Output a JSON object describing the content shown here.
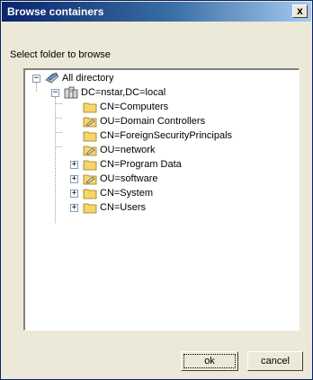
{
  "window": {
    "title": "Browse containers",
    "close_glyph": "x"
  },
  "prompt": "Select folder to browse",
  "tree": {
    "root": {
      "label": "All directory",
      "icon": "directory-icon",
      "expander": "−"
    },
    "domain": {
      "label": "DC=nstar,DC=local",
      "icon": "domain-server-icon",
      "expander": "−"
    },
    "children": [
      {
        "label": "CN=Computers",
        "icon": "folder-icon",
        "expander": ""
      },
      {
        "label": "OU=Domain Controllers",
        "icon": "ou-folder-icon",
        "expander": ""
      },
      {
        "label": "CN=ForeignSecurityPrincipals",
        "icon": "folder-icon",
        "expander": ""
      },
      {
        "label": "OU=network",
        "icon": "ou-folder-icon",
        "expander": ""
      },
      {
        "label": "CN=Program Data",
        "icon": "folder-icon",
        "expander": "+"
      },
      {
        "label": "OU=software",
        "icon": "ou-folder-icon",
        "expander": "+"
      },
      {
        "label": "CN=System",
        "icon": "folder-icon",
        "expander": "+"
      },
      {
        "label": "CN=Users",
        "icon": "folder-icon",
        "expander": "+"
      }
    ]
  },
  "buttons": {
    "ok": "ok",
    "cancel": "cancel"
  },
  "colors": {
    "title_bar": "#0a246a",
    "dialog_bg": "#ece9d8",
    "folder": "#f7d56a"
  }
}
